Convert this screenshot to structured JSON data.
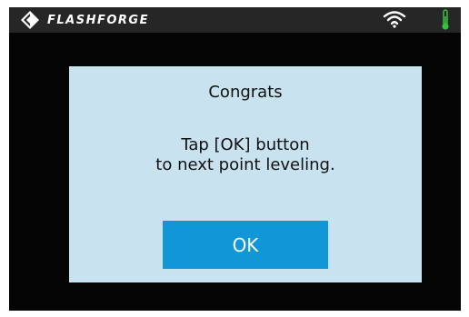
{
  "status_bar": {
    "brand_name": "FLASHFORGE",
    "logo_icon": "flashforge-logo-icon",
    "wifi_icon": "wifi-icon",
    "temperature_icon": "thermometer-icon"
  },
  "dialog": {
    "title": "Congrats",
    "message_line1": "Tap [OK] button",
    "message_line2": "to next point leveling.",
    "ok_label": "OK"
  },
  "colors": {
    "screen_background": "#050505",
    "status_bar_background": "#262626",
    "dialog_background": "#c8e3ef",
    "button_accent": "#1196d8",
    "thermometer": "#35c23a"
  }
}
